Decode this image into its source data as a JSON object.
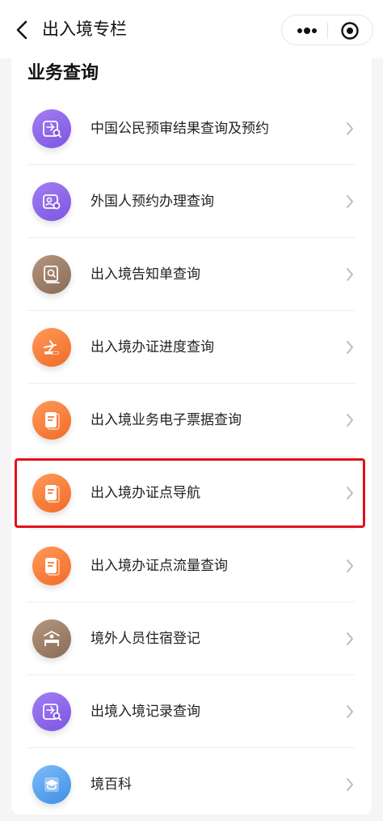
{
  "nav": {
    "title": "出入境专栏",
    "back_icon": "chevron-left-icon",
    "more_icon": "more-dots-icon",
    "close_icon": "target-circle-icon"
  },
  "section": {
    "title": "业务查询"
  },
  "items": [
    {
      "label": "中国公民预审结果查询及预约",
      "icon": "plane-search-icon",
      "color": "#8b63e8"
    },
    {
      "label": "外国人预约办理查询",
      "icon": "id-card-icon",
      "color": "#8b63e8"
    },
    {
      "label": "出入境告知单查询",
      "icon": "notice-search-icon",
      "color": "#9b7c66"
    },
    {
      "label": "出入境办证进度查询",
      "icon": "plane-progress-icon",
      "color": "#f5793a"
    },
    {
      "label": "出入境业务电子票据查询",
      "icon": "receipt-icon",
      "color": "#f5793a"
    },
    {
      "label": "出入境办证点导航",
      "icon": "document-nav-icon",
      "color": "#f5793a"
    },
    {
      "label": "出入境办证点流量查询",
      "icon": "document-flow-icon",
      "color": "#f5793a"
    },
    {
      "label": "境外人员住宿登记",
      "icon": "bed-person-icon",
      "color": "#9b7c66"
    },
    {
      "label": "出境入境记录查询",
      "icon": "plane-record-icon",
      "color": "#8b63e8"
    },
    {
      "label": "境百科",
      "icon": "grad-cap-icon",
      "color": "#4f97ea"
    }
  ],
  "highlight_color": "#e0131a"
}
